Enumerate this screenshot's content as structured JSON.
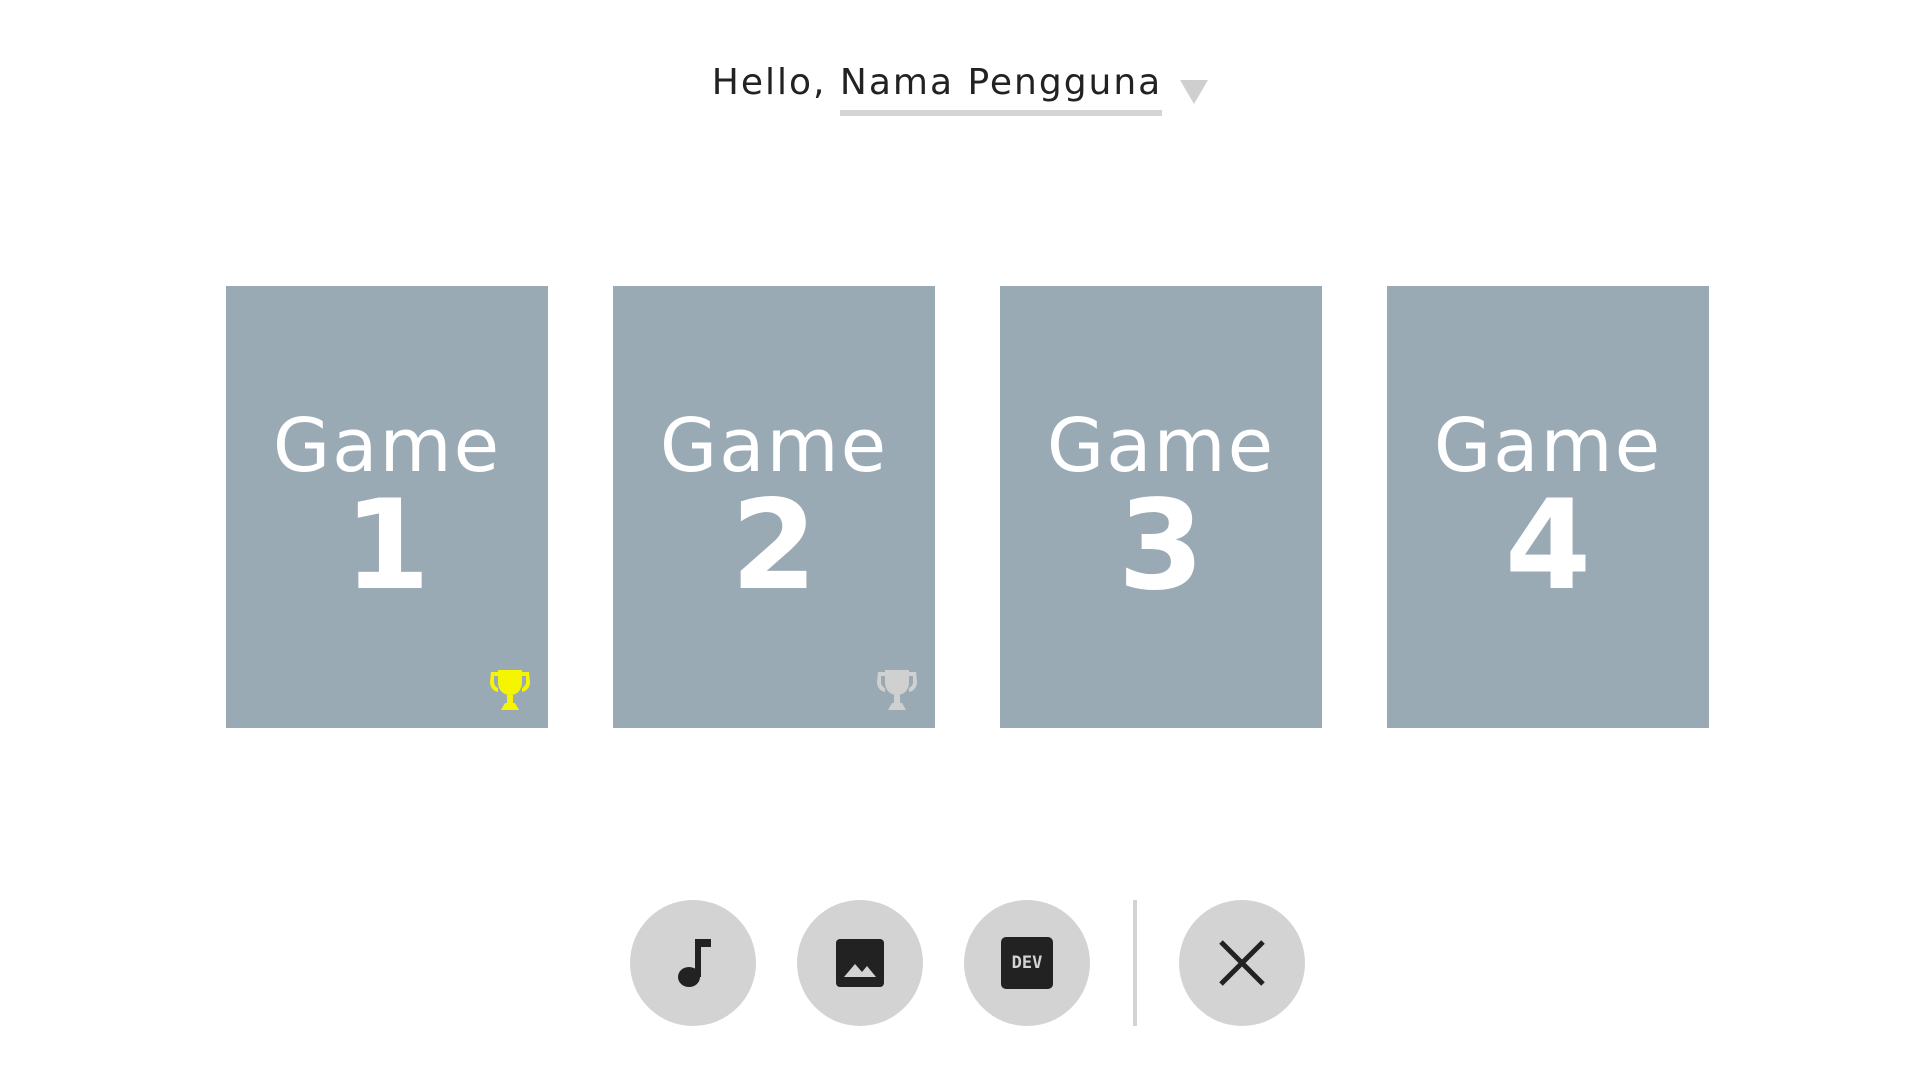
{
  "header": {
    "greeting": "Hello, ",
    "username": "Nama Pengguna"
  },
  "games": [
    {
      "title": "Game",
      "number": "1",
      "trophy": "trophy-icon",
      "trophy_color": "#f5f500"
    },
    {
      "title": "Game",
      "number": "2",
      "trophy": "trophy-icon",
      "trophy_color": "#d0d0d0"
    },
    {
      "title": "Game",
      "number": "3"
    },
    {
      "title": "Game",
      "number": "4"
    }
  ],
  "toolbar": {
    "music_icon": "music-note-icon",
    "background_icon": "image-icon",
    "dev_label": "DEV",
    "close_icon": "close-icon"
  },
  "colors": {
    "card_background": "#9aaab4",
    "button_background": "#d3d3d3",
    "trophy_gold": "#f5f500",
    "trophy_silver": "#d0d0d0"
  }
}
